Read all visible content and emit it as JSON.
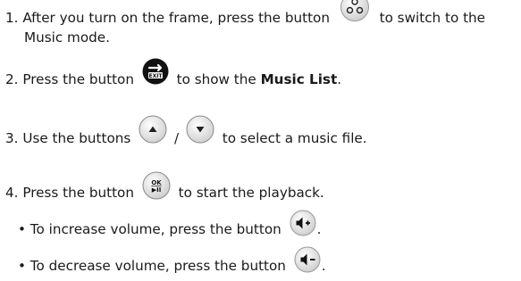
{
  "steps": [
    {
      "number": "1.",
      "before": "After you turn on the frame, press the button",
      "after": "to switch to the",
      "continuation": "Music mode.",
      "icon": "mode-switch-icon"
    },
    {
      "number": "2.",
      "before": "Press the button",
      "after": "to show the",
      "bold": "Music List",
      "end": ".",
      "icon": "menu-exit-icon"
    },
    {
      "number": "3.",
      "before": "Use the buttons",
      "separator": "/",
      "after": "to select a music file.",
      "icons": [
        "up-arrow-icon",
        "down-arrow-icon"
      ]
    },
    {
      "number": "4.",
      "before": "Press the button",
      "after": "to start the playback.",
      "icon": "ok-play-pause-icon",
      "icon_text_top": "OK",
      "icon_text_bottom": "▶II"
    }
  ],
  "bullets": [
    {
      "marker": "•",
      "text": "To increase volume, press the button",
      "end": ".",
      "icon": "volume-up-icon"
    },
    {
      "marker": "•",
      "text": "To decrease volume, press the button",
      "end": ".",
      "icon": "volume-down-icon"
    }
  ],
  "colors": {
    "text": "#1a1a1a",
    "icon_dark": "#111111",
    "icon_light_stroke": "#888888"
  }
}
